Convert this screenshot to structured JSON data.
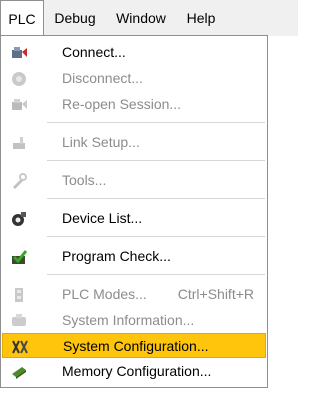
{
  "menubar": {
    "items": [
      {
        "label": "PLC",
        "active": true
      },
      {
        "label": "Debug"
      },
      {
        "label": "Window"
      },
      {
        "label": "Help"
      }
    ]
  },
  "plc_menu": {
    "items": [
      {
        "label": "Connect...",
        "icon": "connect-icon",
        "enabled": true
      },
      {
        "label": "Disconnect...",
        "icon": "disconnect-icon",
        "enabled": false
      },
      {
        "label": "Re-open Session...",
        "icon": "reopen-session-icon",
        "enabled": false
      },
      {
        "label": "Link Setup...",
        "icon": "link-setup-icon",
        "enabled": false
      },
      {
        "label": "Tools...",
        "icon": "tools-icon",
        "enabled": false
      },
      {
        "label": "Device List...",
        "icon": "device-list-icon",
        "enabled": true
      },
      {
        "label": "Program Check...",
        "icon": "program-check-icon",
        "enabled": true
      },
      {
        "label": "PLC Modes...",
        "shortcut": "Ctrl+Shift+R",
        "icon": "plc-modes-icon",
        "enabled": false
      },
      {
        "label": "System Information...",
        "icon": "system-information-icon",
        "enabled": false
      },
      {
        "label": "System Configuration...",
        "icon": "system-configuration-icon",
        "enabled": true,
        "highlighted": true
      },
      {
        "label": "Memory Configuration...",
        "icon": "memory-configuration-icon",
        "enabled": true
      }
    ]
  },
  "colors": {
    "highlight": "#ffc40c",
    "disabled_text": "#8c8c8c",
    "menubar_bg": "#f0f0f0"
  }
}
